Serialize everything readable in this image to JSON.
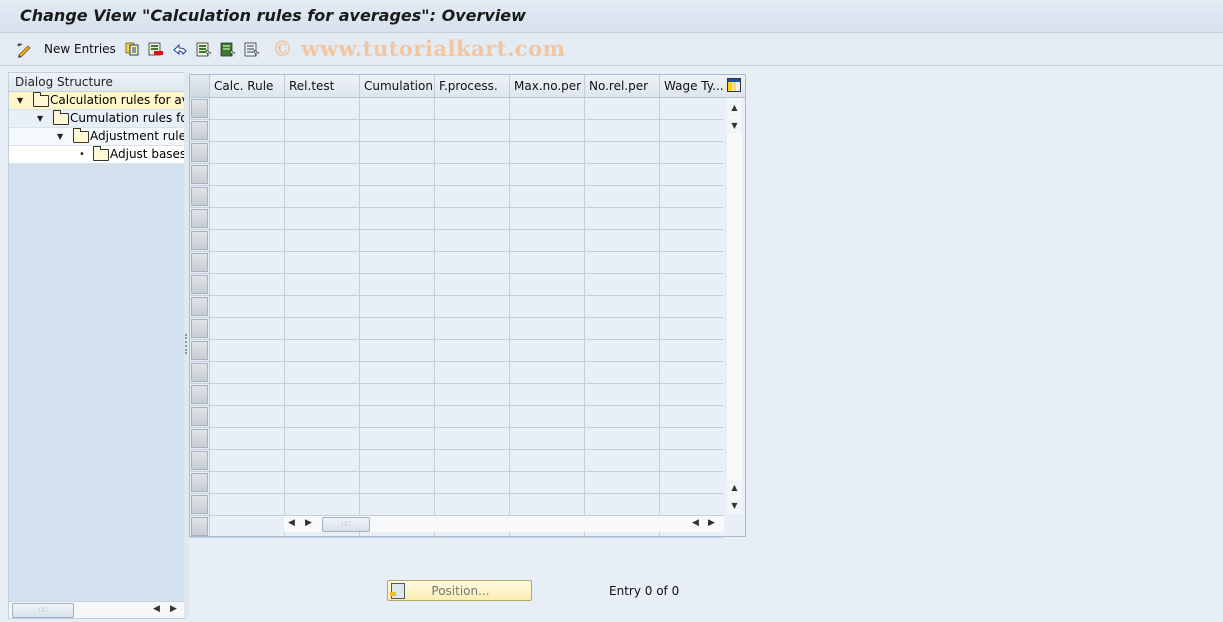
{
  "window": {
    "title": "Change View \"Calculation rules for averages\": Overview"
  },
  "toolbar": {
    "items": [
      {
        "icon": "edit-pencil-icon",
        "label": "New Entries"
      },
      {
        "icon": "copy-icon"
      },
      {
        "icon": "delete-icon"
      },
      {
        "icon": "undo-icon"
      },
      {
        "icon": "select-all-icon"
      },
      {
        "icon": "select-block-icon"
      },
      {
        "icon": "deselect-all-icon"
      }
    ],
    "watermark": "© www.tutorialkart.com"
  },
  "dialog_structure": {
    "header": "Dialog Structure",
    "items": [
      {
        "label": "Calculation rules for aver",
        "level": 0,
        "expanded": true,
        "selected": true,
        "open_folder": true
      },
      {
        "label": "Cumulation rules for",
        "level": 1,
        "expanded": true,
        "selected": false
      },
      {
        "label": "Adjustment rules",
        "level": 2,
        "expanded": true,
        "selected": false
      },
      {
        "label": "Adjust bases",
        "level": 3,
        "expanded": false,
        "leaf": true,
        "selected": false
      }
    ]
  },
  "table": {
    "columns": [
      "Calc. Rule",
      "Rel.test",
      "Cumulation",
      "F.process.",
      "Max.no.per",
      "No.rel.per",
      "Wage Ty..."
    ],
    "row_count": 20,
    "rows": []
  },
  "footer": {
    "position_button": "Position...",
    "entry_text": "Entry 0 of 0"
  },
  "colors": {
    "selected_tree_bg": "#fff7c9",
    "background": "#e8eef5",
    "sidebar_bg": "#d3e1ef",
    "position_button_bg": "#faeeb0"
  }
}
